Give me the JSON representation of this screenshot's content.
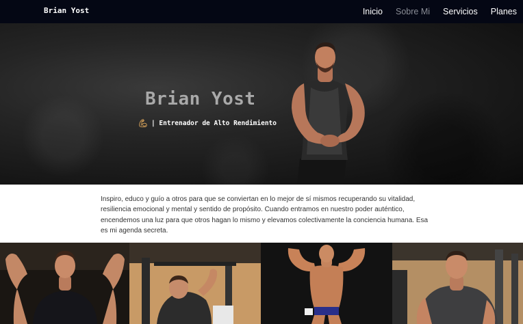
{
  "nav": {
    "brand": "Brian Yost",
    "links": [
      {
        "label": "Inicio",
        "active": false
      },
      {
        "label": "Sobre Mi",
        "active": true
      },
      {
        "label": "Servicios",
        "active": false
      },
      {
        "label": "Planes",
        "active": false
      }
    ]
  },
  "hero": {
    "title": "Brian Yost",
    "icon": "flexed-bicep-icon",
    "subtitle": "| Entrenador de Alto Rendimiento",
    "image": "athlete-portrait"
  },
  "intro": {
    "text": "Inspiro, educo y guío a otros para que se conviertan en lo mejor de sí mismos recuperando su vitalidad, resiliencia emocional y mental y sentido de propósito. Cuando entramos en nuestro poder auténtico, encendemos una luz para que otros hagan lo mismo y elevamos colectivamente la conciencia humana. Esa es mi agenda secreta."
  },
  "gallery": {
    "photos": [
      "gym-flex-photo",
      "gym-training-photo",
      "stage-pose-photo",
      "gym-portrait-photo"
    ]
  },
  "colors": {
    "navbar": "#040714",
    "active_link": "#8a8d96",
    "hero_title": "#a9a9a9",
    "accent": "#d9a35a"
  }
}
